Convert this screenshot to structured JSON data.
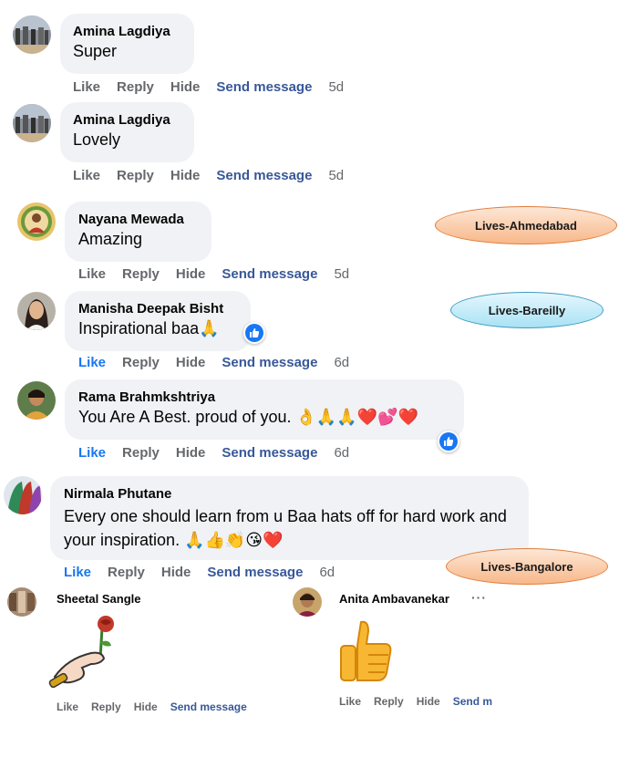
{
  "comments": [
    {
      "name": "Amina Lagdiya",
      "text": "Super",
      "like": "Like",
      "reply": "Reply",
      "hide": "Hide",
      "send": "Send message",
      "time": "5d"
    },
    {
      "name": "Amina Lagdiya",
      "text": "Lovely",
      "like": "Like",
      "reply": "Reply",
      "hide": "Hide",
      "send": "Send message",
      "time": "5d"
    },
    {
      "name": "Nayana Mewada",
      "text": "Amazing",
      "like": "Like",
      "reply": "Reply",
      "hide": "Hide",
      "send": "Send message",
      "time": "5d"
    },
    {
      "name": "Manisha Deepak Bisht",
      "text": "Inspirational baa🙏",
      "like": "Like",
      "reply": "Reply",
      "hide": "Hide",
      "send": "Send message",
      "time": "6d"
    },
    {
      "name": "Rama Brahmkshtriya",
      "text": "You Are A Best. proud of you. 👌🙏🙏❤️💕❤️",
      "like": "Like",
      "reply": "Reply",
      "hide": "Hide",
      "send": "Send message",
      "time": "6d"
    },
    {
      "name": "Nirmala Phutane",
      "text": "Every one should learn from u Baa hats off for hard work and your inspiration. 🙏👍👏😘❤️",
      "like": "Like",
      "reply": "Reply",
      "hide": "Hide",
      "send": "Send message",
      "time": "6d"
    }
  ],
  "sticker_comments": [
    {
      "name": "Sheetal Sangle",
      "like": "Like",
      "reply": "Reply",
      "hide": "Hide",
      "send": "Send message",
      "sticker": "hand-with-rose"
    },
    {
      "name": "Anita Ambavanekar",
      "more": "···",
      "like": "Like",
      "reply": "Reply",
      "hide": "Hide",
      "send": "Send m",
      "sticker": "thumbs-up"
    }
  ],
  "tags": [
    "Lives-Ahmedabad",
    "Lives-Bareilly",
    "Lives-Bangalore"
  ],
  "colors": {
    "accent": "#1877f2",
    "link": "#385898",
    "bubble": "#f0f2f5",
    "muted": "#65676b"
  }
}
